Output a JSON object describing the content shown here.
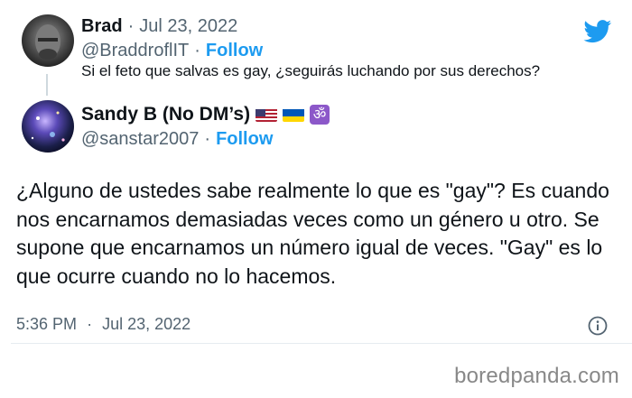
{
  "parent_tweet": {
    "display_name": "Brad",
    "date": "Jul 23, 2022",
    "handle": "@BraddroflIT",
    "follow_label": "Follow",
    "text": "Si el feto que salvas es gay, ¿seguirás luchando por sus derechos?"
  },
  "main_tweet": {
    "display_name": "Sandy B (No DM’s)",
    "emoji_flags": [
      "us-flag",
      "ukraine-flag",
      "om-symbol"
    ],
    "handle": "@sanstar2007",
    "follow_label": "Follow",
    "text": "¿Alguno de ustedes sabe realmente lo que es \"gay\"? Es cuando nos encarnamos demasiadas veces como un género u otro. Se supone que encarnamos un número igual de veces. \"Gay\" es lo que ocurre cuando no lo hacemos.",
    "time": "5:36 PM",
    "date": "Jul 23, 2022"
  },
  "brand": {
    "watermark": "boredpanda.com"
  },
  "colors": {
    "accent": "#1d9bf0",
    "muted": "#536471",
    "text": "#0f1419"
  }
}
